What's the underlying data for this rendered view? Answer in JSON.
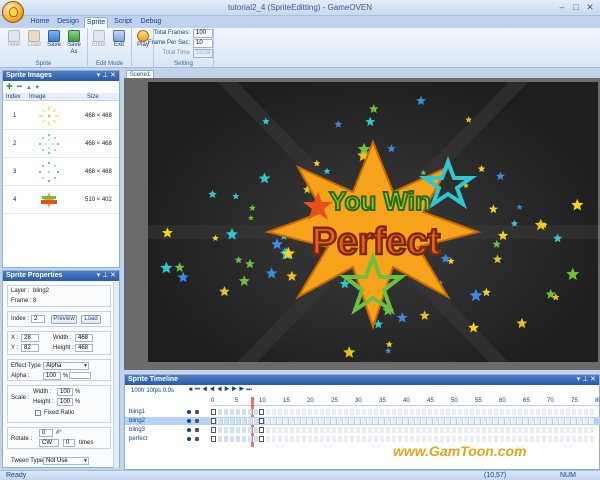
{
  "window": {
    "title": "tutorial2_4 (SpriteEditting) - GameOVEN",
    "minimize": "–",
    "maximize": "□",
    "close": "✕"
  },
  "tabs": [
    {
      "label": "Home"
    },
    {
      "label": "Design"
    },
    {
      "label": "Sprite"
    },
    {
      "label": "Script"
    },
    {
      "label": "Debug"
    }
  ],
  "ribbon": {
    "sprite_group": {
      "label": "Sprite",
      "buttons": [
        "New",
        "Load",
        "Save",
        "Save As"
      ]
    },
    "edit_group": {
      "label": "Edit Mode",
      "buttons": [
        "Enter",
        "Exit"
      ]
    },
    "play_group": {
      "button": "Play"
    },
    "setting_group": {
      "label": "Setting",
      "total_frames_label": "Total Frames:",
      "total_frames": "100",
      "fps_label": "Frame Per Sec:",
      "fps": "10",
      "total_time_label": "Total Time",
      "total_time": "10.0s"
    }
  },
  "sprite_images": {
    "title": "Sprite Images",
    "pin": "▾ ⊥ ✕",
    "columns": [
      "Index",
      "Image",
      "Size"
    ],
    "rows": [
      {
        "index": "1",
        "size": "468 × 468"
      },
      {
        "index": "2",
        "size": "468 × 468"
      },
      {
        "index": "3",
        "size": "468 × 468"
      },
      {
        "index": "4",
        "size": "510 × 402"
      }
    ]
  },
  "sprite_properties": {
    "title": "Sprite Properties",
    "pin": "▾ ⊥ ✕",
    "layer_label": "Layer :",
    "layer_value": "bling2",
    "frame_label": "Frame :",
    "frame_value": "8",
    "index_label": "Index :",
    "index_value": "2",
    "preview_button": "Preview",
    "load_button": "Load",
    "x_label": "X :",
    "x_value": "28",
    "y_label": "Y :",
    "y_value": "82",
    "width_label": "Width :",
    "width_value": "468",
    "height_label": "Height :",
    "height_value": "468",
    "effect_label": "Effect Type :",
    "effect_value": "Alpha",
    "alpha_label": "Alpha :",
    "alpha_value": "100",
    "alpha_unit": "%",
    "scale_label": "Scale :",
    "scale_width_label": "Width :",
    "scale_width_value": "100",
    "scale_width_unit": "%",
    "scale_height_label": "Height :",
    "scale_height_value": "100",
    "scale_height_unit": "%",
    "fixed_ratio": "Fixed Ratio",
    "rotate_label": "Rotate :",
    "rotate_value": "0",
    "rotate_unit": "#°",
    "rotate_dir": "CW",
    "rotate_times": "0",
    "rotate_times_label": "times",
    "tween_label": "Tween Type",
    "tween_value": "Not Use"
  },
  "scene": {
    "tab": "Scene1",
    "text1": "You Win",
    "text2": "Perfect"
  },
  "timeline": {
    "title": "Sprite Timeline",
    "pin": "▾ ⊥ ✕",
    "info": "100fr 10fps 0.9s",
    "controls": [
      "■",
      "⏮",
      "◀◀",
      "◀",
      "▶",
      "▶▶",
      "⏭"
    ],
    "ruler": [
      "0",
      "5",
      "10",
      "15",
      "20",
      "25",
      "30",
      "35",
      "40",
      "45",
      "50",
      "55",
      "60",
      "65",
      "70",
      "75",
      "80"
    ],
    "layers": [
      "bling1",
      "bling2",
      "bling3",
      "perfect"
    ]
  },
  "watermark": "www.GamToon.com",
  "status": {
    "left": "Ready",
    "coords": "(10,57)",
    "num": "NUM"
  }
}
